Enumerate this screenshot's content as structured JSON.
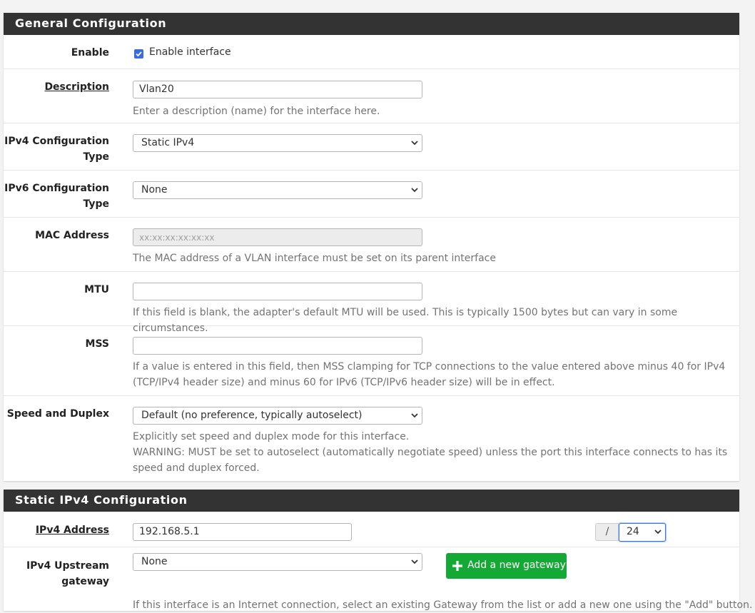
{
  "general": {
    "heading": "General Configuration",
    "enable": {
      "label": "Enable",
      "checkbox_label": "Enable interface",
      "checked": true
    },
    "description": {
      "label": "Description",
      "value": "Vlan20",
      "help": "Enter a description (name) for the interface here."
    },
    "ipv4_type": {
      "label_line1": "IPv4 Configuration",
      "label_line2": "Type",
      "value": "Static IPv4"
    },
    "ipv6_type": {
      "label_line1": "IPv6 Configuration",
      "label_line2": "Type",
      "value": "None"
    },
    "mac": {
      "label": "MAC Address",
      "placeholder": "xx:xx:xx:xx:xx:xx",
      "help": "The MAC address of a VLAN interface must be set on its parent interface"
    },
    "mtu": {
      "label": "MTU",
      "value": "",
      "help": "If this field is blank, the adapter's default MTU will be used. This is typically 1500 bytes but can vary in some circumstances."
    },
    "mss": {
      "label": "MSS",
      "value": "",
      "help_line1": "If a value is entered in this field, then MSS clamping for TCP connections to the value entered above minus 40 for IPv4",
      "help_line2": "(TCP/IPv4 header size) and minus 60 for IPv6 (TCP/IPv6 header size) will be in effect."
    },
    "speed": {
      "label": "Speed and Duplex",
      "value": "Default (no preference, typically autoselect)",
      "help_line1": "Explicitly set speed and duplex mode for this interface.",
      "help_line2": "WARNING: MUST be set to autoselect (automatically negotiate speed) unless the port this interface connects to has its",
      "help_line3": "speed and duplex forced."
    }
  },
  "static_ipv4": {
    "heading": "Static IPv4 Configuration",
    "address": {
      "label": "IPv4 Address",
      "value": "192.168.5.1",
      "slash": "/",
      "cidr": "24"
    },
    "gateway": {
      "label_line1": "IPv4 Upstream",
      "label_line2": "gateway",
      "value": "None",
      "add_button": "Add a new gateway",
      "help": "If this interface is an Internet connection, select an existing Gateway from the list or add a new one using the \"Add\" button."
    }
  },
  "colors": {
    "heading_bg": "#333333",
    "accent": "#3a6be0",
    "success": "#14a835"
  },
  "icons": {
    "checkbox": "checkmark-icon",
    "select": "chevron-down-icon",
    "add": "plus-icon"
  }
}
